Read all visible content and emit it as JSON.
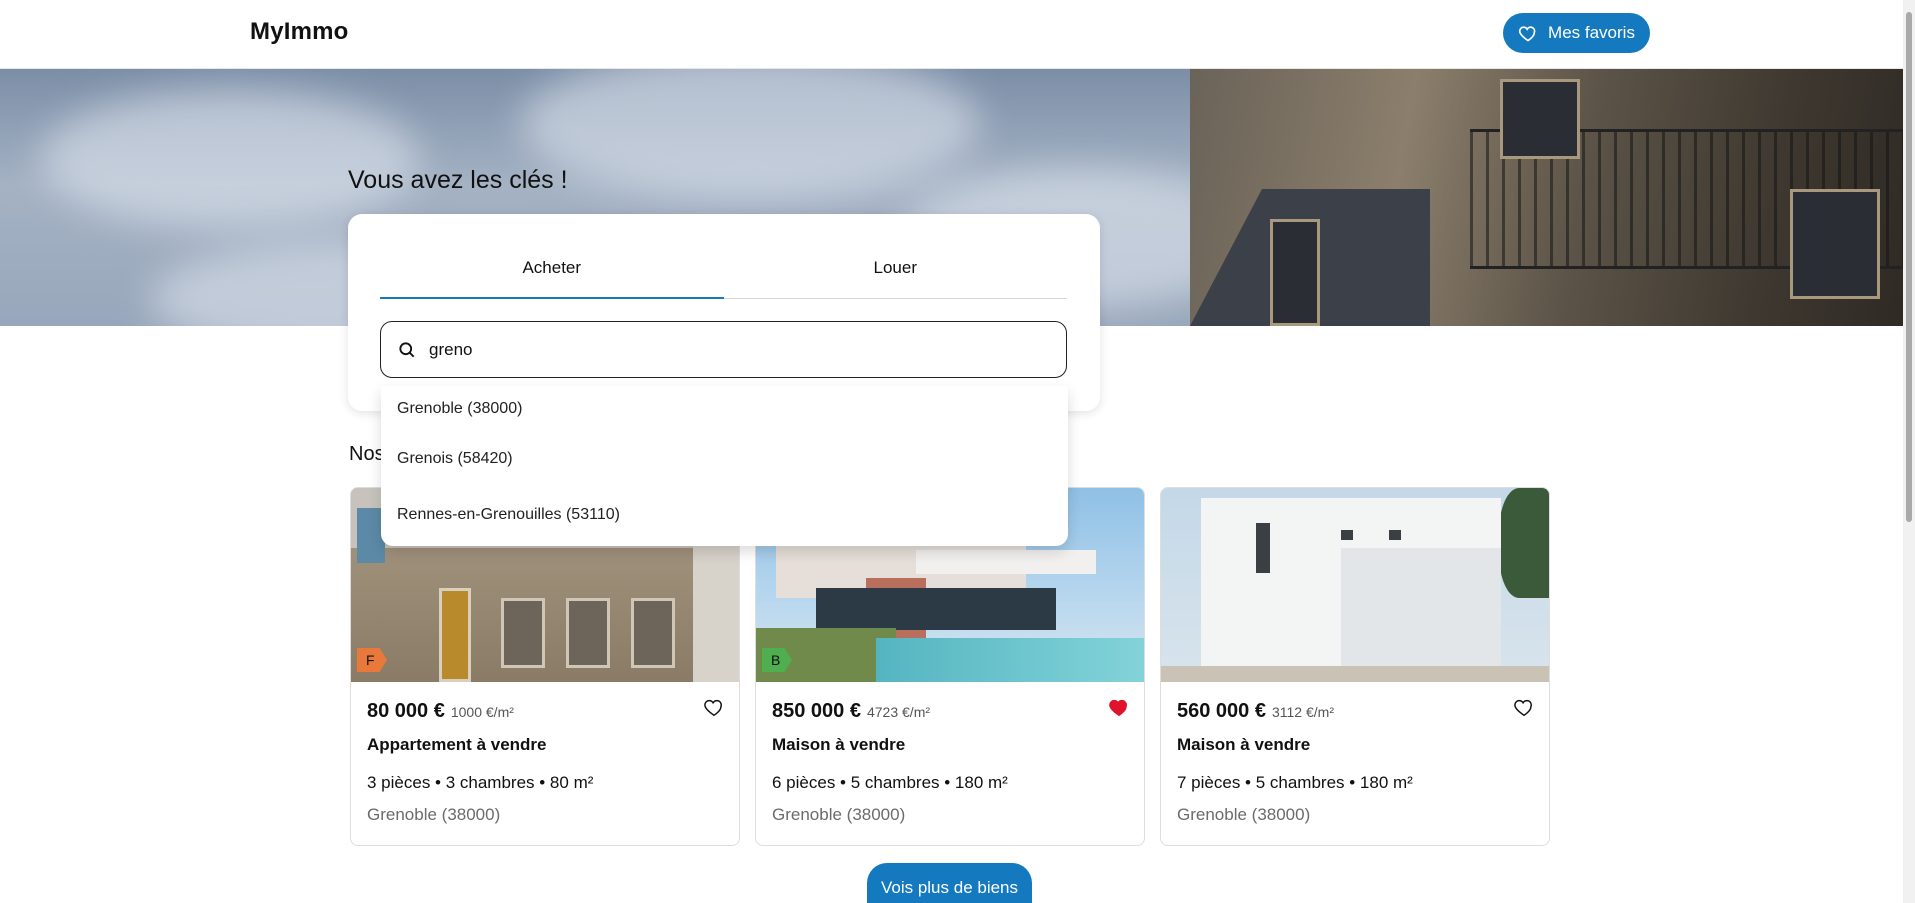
{
  "header": {
    "logo": "MyImmo",
    "favorites_label": "Mes favoris"
  },
  "hero": {
    "title": "Vous avez les clés !"
  },
  "search": {
    "tabs": [
      {
        "label": "Acheter",
        "active": true
      },
      {
        "label": "Louer",
        "active": false
      }
    ],
    "query": "greno",
    "suggestions": [
      "Grenoble (38000)",
      "Grenois (58420)",
      "Rennes-en-Grenouilles (53110)"
    ]
  },
  "section": {
    "title": "Nos"
  },
  "listings": [
    {
      "energy_class": "F",
      "energy_color": "#e8793a",
      "price": "80 000 €",
      "price_per_m2": "1000 €/m²",
      "type": "Appartement à vendre",
      "specs": "3 pièces  •  3 chambres  •  80 m²",
      "location": "Grenoble (38000)",
      "favorite": false
    },
    {
      "energy_class": "B",
      "energy_color": "#4fae4f",
      "price": "850 000 €",
      "price_per_m2": "4723 €/m²",
      "type": "Maison à vendre",
      "specs": "6 pièces  •  5 chambres  •  180 m²",
      "location": "Grenoble (38000)",
      "favorite": true
    },
    {
      "energy_class": "",
      "energy_color": "",
      "price": "560 000 €",
      "price_per_m2": "3112 €/m²",
      "type": "Maison à vendre",
      "specs": "7 pièces  •  5 chambres  •  180 m²",
      "location": "Grenoble (38000)",
      "favorite": false
    }
  ],
  "more_button": "Vois plus de biens",
  "colors": {
    "accent": "#1479bf",
    "favorite_active": "#e0132c"
  },
  "icons": {
    "favorites": "heart-outline-icon",
    "search": "search-icon"
  }
}
